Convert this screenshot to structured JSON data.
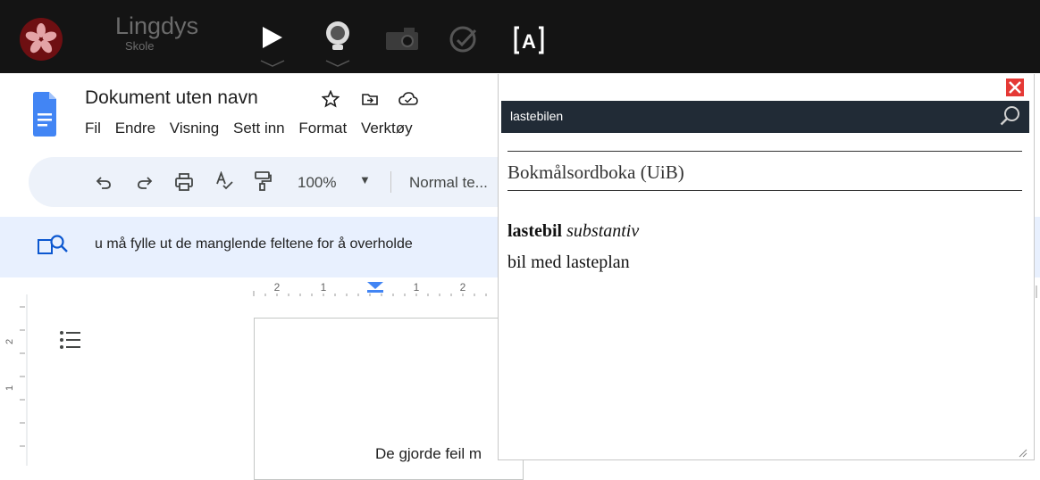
{
  "lingdys": {
    "brand": "Lingdys",
    "brand_sub": "Skole",
    "icons": [
      "logo-flower-icon",
      "play-icon",
      "globe-head-icon",
      "camera-icon",
      "check-circle-icon",
      "bracket-a-icon"
    ],
    "letter_icon": "A"
  },
  "docs": {
    "title": "Dokument uten navn",
    "menu": [
      "Fil",
      "Endre",
      "Visning",
      "Sett inn",
      "Format",
      "Verktøy"
    ],
    "toolbar": {
      "zoom": "100%",
      "style": "Normal te..."
    },
    "banner": "u må fylle ut de manglende feltene for å overholde",
    "ruler_labels": [
      "2",
      "1",
      "1",
      "2"
    ],
    "vruler_labels": [
      "2",
      "1"
    ],
    "body_text": "De gjorde feil m"
  },
  "dictionary": {
    "search_value": "lastebilen",
    "source": "Bokmålsordboka (UiB)",
    "headword": "lastebil",
    "word_class": "substantiv",
    "definition": "bil med lasteplan"
  },
  "colors": {
    "lingdys_bar": "#141414",
    "logo": "#6e0f12",
    "docs_blue": "#4285f4",
    "toolbar_bg": "#edf2fa",
    "banner_bg": "#e8f0fe",
    "dict_search_bg": "#212b36",
    "close_red": "#e53935"
  }
}
